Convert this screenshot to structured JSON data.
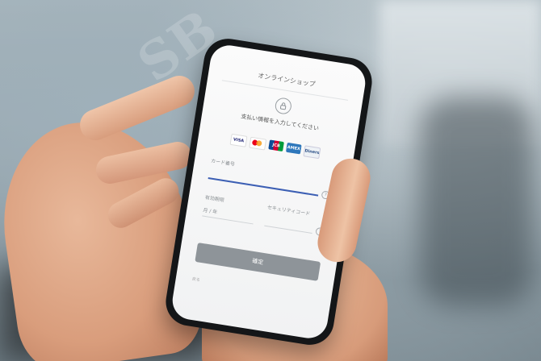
{
  "phone_screen": {
    "title": "オンラインショップ",
    "prompt": "支払い情報を入力してください",
    "cards": [
      {
        "name": "VISA",
        "color": "#1a1f71"
      },
      {
        "name": "Mastercard",
        "color": "#eb001b"
      },
      {
        "name": "JCB",
        "color": "#0e4c96"
      },
      {
        "name": "AMEX",
        "color": "#2e77bb"
      },
      {
        "name": "Diners",
        "color": "#2a4e86"
      }
    ],
    "fields": {
      "card_number_label": "カード番号",
      "expiry_label": "有効期限",
      "security_code_label": "セキュリティコード",
      "expiry_placeholder": "月 / 年"
    },
    "submit_label": "確定",
    "footer_text": "戻る"
  },
  "watermark": "SB",
  "icons": [
    "lock-icon",
    "help-icon"
  ]
}
